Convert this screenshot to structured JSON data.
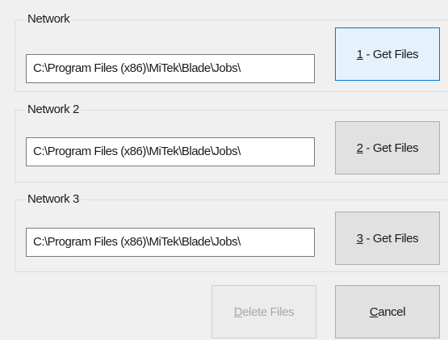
{
  "groups": [
    {
      "label": "Network",
      "path_value": "C:\\Program Files (x86)\\MiTek\\Blade\\Jobs\\",
      "button_mnemonic": "1",
      "button_rest": " - Get Files"
    },
    {
      "label": "Network 2",
      "path_value": "C:\\Program Files (x86)\\MiTek\\Blade\\Jobs\\",
      "button_mnemonic": "2",
      "button_rest": " - Get Files"
    },
    {
      "label": "Network 3",
      "path_value": "C:\\Program Files (x86)\\MiTek\\Blade\\Jobs\\",
      "button_mnemonic": "3",
      "button_rest": " - Get Files"
    }
  ],
  "footer": {
    "delete_mnemonic": "D",
    "delete_rest": "elete Files",
    "cancel_mnemonic": "C",
    "cancel_rest": "ancel"
  }
}
